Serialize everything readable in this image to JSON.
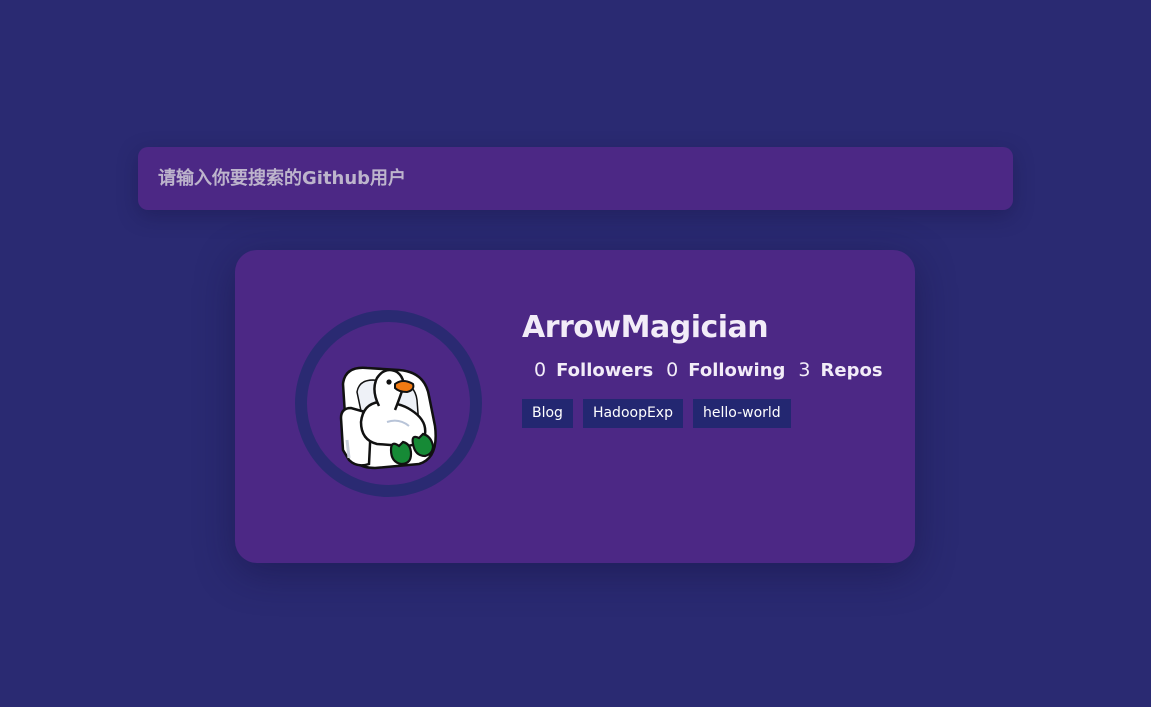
{
  "search": {
    "placeholder": "请输入你要搜索的Github用户",
    "value": ""
  },
  "profile": {
    "name": "ArrowMagician",
    "avatar_icon": "goose-in-armchair-avatar",
    "stats": [
      {
        "count": "0",
        "label": "Followers"
      },
      {
        "count": "0",
        "label": "Following"
      },
      {
        "count": "3",
        "label": "Repos"
      }
    ],
    "repos": [
      "Blog",
      "HadoopExp",
      "hello-world"
    ]
  },
  "colors": {
    "page_background": "#2a2a72",
    "panel_background": "#4c2885",
    "avatar_ring": "#2a2a72",
    "repo_tag_background": "#232771",
    "text_primary": "#f2ecf8",
    "placeholder_text": "#bdb4cc"
  }
}
